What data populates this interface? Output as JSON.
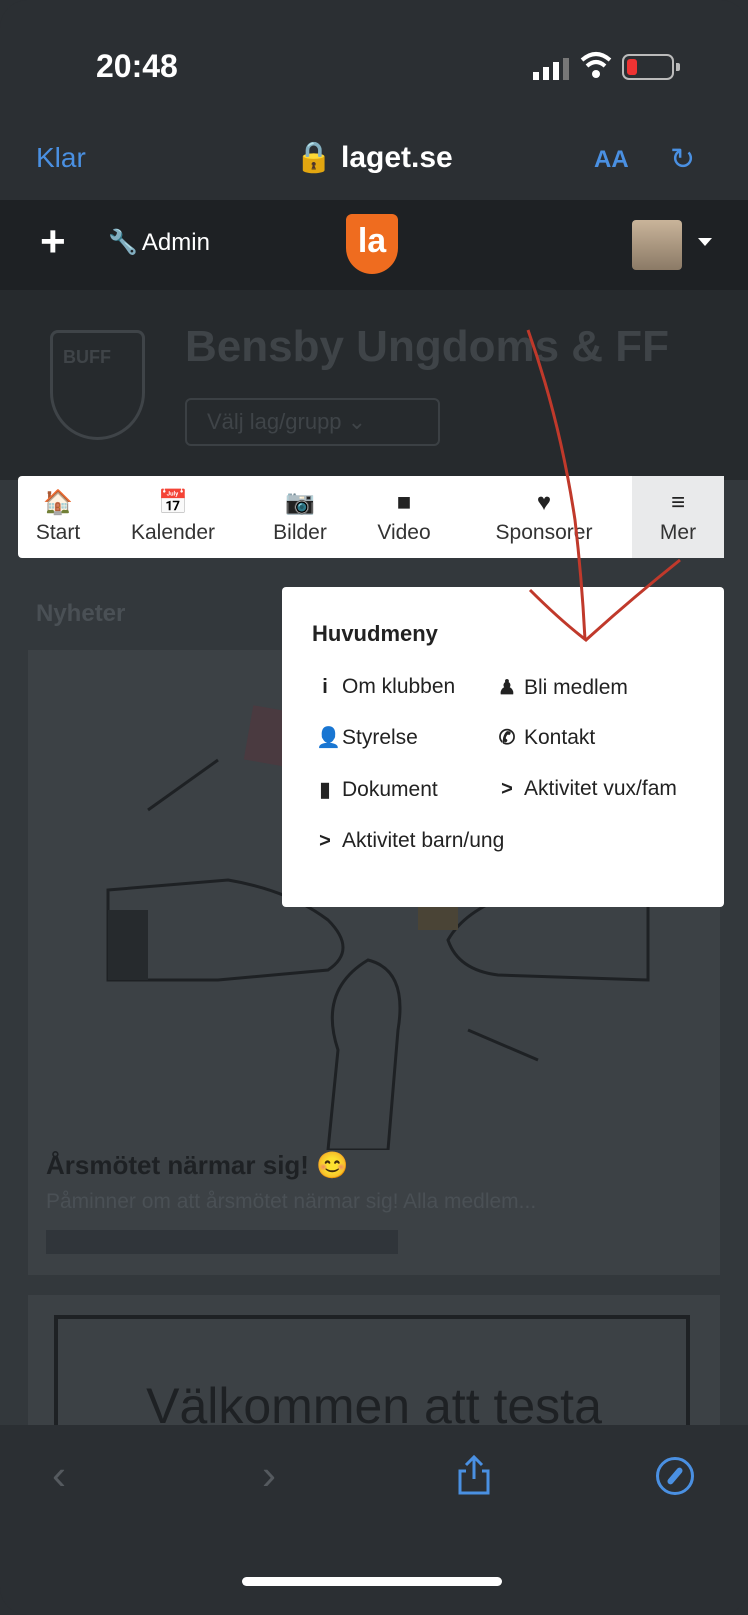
{
  "status_bar": {
    "time": "20:48"
  },
  "browser": {
    "done_label": "Klar",
    "url": "laget.se",
    "text_size_label": "AA",
    "reload_glyph": "↻"
  },
  "site_header": {
    "add_glyph": "+",
    "admin_label": "Admin",
    "logo_text": "la"
  },
  "club": {
    "crest_text": "BUFF",
    "name": "Bensby Ungdoms & FF",
    "group_selector": "Välj lag/grupp ⌄"
  },
  "nav": {
    "items": [
      {
        "icon": "home-icon",
        "glyph": "🏠",
        "label": "Start"
      },
      {
        "icon": "calendar-icon",
        "glyph": "📅",
        "label": "Kalender"
      },
      {
        "icon": "camera-icon",
        "glyph": "📷",
        "label": "Bilder"
      },
      {
        "icon": "video-icon",
        "glyph": "■",
        "label": "Video"
      },
      {
        "icon": "heart-icon",
        "glyph": "♥",
        "label": "Sponsorer"
      },
      {
        "icon": "hamburger-icon",
        "glyph": "≡",
        "label": "Mer"
      }
    ]
  },
  "menu": {
    "title": "Huvudmeny",
    "items": [
      {
        "icon": "info-icon",
        "glyph": "i",
        "label": "Om klubben"
      },
      {
        "icon": "person-icon",
        "glyph": "♟",
        "label": "Bli medlem"
      },
      {
        "icon": "user-icon",
        "glyph": "👤",
        "label": "Styrelse"
      },
      {
        "icon": "phone-icon",
        "glyph": "✆",
        "label": "Kontakt"
      },
      {
        "icon": "file-icon",
        "glyph": "▮",
        "label": "Dokument"
      },
      {
        "icon": "chevron-right-icon",
        "glyph": ">",
        "label": "Aktivitet vux/fam"
      },
      {
        "icon": "chevron-right-icon",
        "glyph": ">",
        "label": "Aktivitet barn/ung"
      }
    ]
  },
  "news": {
    "section_label": "Nyheter",
    "title": "Årsmötet närmar sig! 😊",
    "excerpt": "Påminner om att årsmötet närmar sig! Alla medlem...",
    "welcome_text": "Välkommen att testa"
  },
  "safari_toolbar": {
    "back_glyph": "‹",
    "forward_glyph": "›"
  },
  "colors": {
    "accent_blue": "#4a90e2",
    "laget_orange": "#ef6c1f",
    "annotation_red": "#c0392b"
  }
}
